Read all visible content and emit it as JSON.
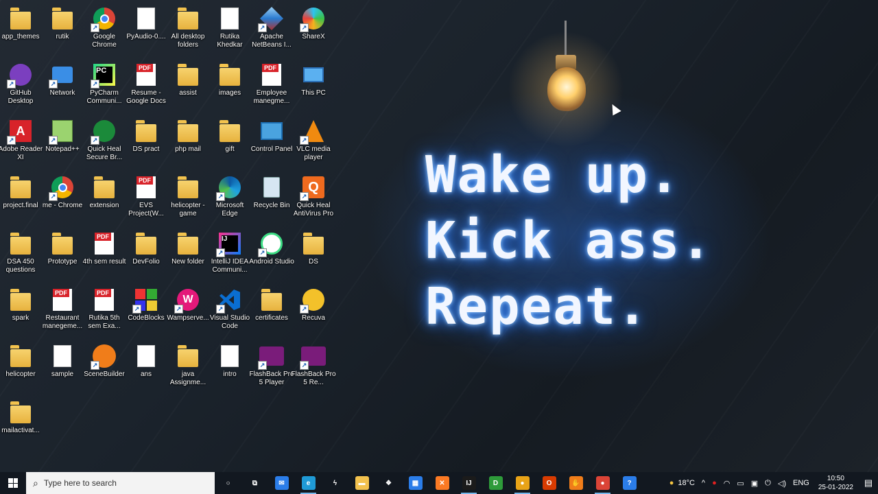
{
  "wallpaper": {
    "lines": [
      "Wake up.",
      "Kick ass.",
      "Repeat."
    ]
  },
  "desktop": {
    "icons": [
      {
        "label": "app_themes",
        "type": "folder"
      },
      {
        "label": "rutik",
        "type": "folder"
      },
      {
        "label": "Google Chrome",
        "type": "chrome"
      },
      {
        "label": "PyAudio-0....",
        "type": "doc"
      },
      {
        "label": "All desktop folders",
        "type": "folder"
      },
      {
        "label": "Rutika Khedkar",
        "type": "doc"
      },
      {
        "label": "Apache NetBeans I...",
        "type": "netbeans"
      },
      {
        "label": "ShareX",
        "type": "sharex"
      },
      {
        "label": "GitHub Desktop",
        "type": "github"
      },
      {
        "label": "Network",
        "type": "network"
      },
      {
        "label": "PyCharm Communi...",
        "type": "pycharm"
      },
      {
        "label": "Resume - Google Docs",
        "type": "pdf"
      },
      {
        "label": "assist",
        "type": "folder"
      },
      {
        "label": "images",
        "type": "folder"
      },
      {
        "label": "Employee manegme...",
        "type": "pdf"
      },
      {
        "label": "This PC",
        "type": "pc"
      },
      {
        "label": "Adobe Reader XI",
        "type": "adobe"
      },
      {
        "label": "Notepad++",
        "type": "notepad"
      },
      {
        "label": "Quick Heal Secure Br...",
        "type": "quickheal-browser"
      },
      {
        "label": "DS pract",
        "type": "folder"
      },
      {
        "label": "php mail",
        "type": "folder"
      },
      {
        "label": "gift",
        "type": "folder"
      },
      {
        "label": "Control Panel",
        "type": "control"
      },
      {
        "label": "VLC media player",
        "type": "vlc"
      },
      {
        "label": "project.final",
        "type": "folder"
      },
      {
        "label": "me - Chrome",
        "type": "chrome"
      },
      {
        "label": "extension",
        "type": "folder"
      },
      {
        "label": "EVS Project(W...",
        "type": "pdf"
      },
      {
        "label": "helicopter -game",
        "type": "folder"
      },
      {
        "label": "Microsoft Edge",
        "type": "edge"
      },
      {
        "label": "Recycle Bin",
        "type": "recycle"
      },
      {
        "label": "Quick Heal AntiVirus Pro",
        "type": "quickheal"
      },
      {
        "label": "DSA 450 questions",
        "type": "folder"
      },
      {
        "label": "Prototype",
        "type": "folder"
      },
      {
        "label": "4th sem result",
        "type": "pdf"
      },
      {
        "label": "DevFolio",
        "type": "folder"
      },
      {
        "label": "New folder",
        "type": "folder"
      },
      {
        "label": "IntelliJ IDEA Communi...",
        "type": "intellij"
      },
      {
        "label": "Android Studio",
        "type": "android"
      },
      {
        "label": "DS",
        "type": "folder"
      },
      {
        "label": "spark",
        "type": "folder"
      },
      {
        "label": "Restaurant manegeme...",
        "type": "pdf"
      },
      {
        "label": "Rutika 5th sem Exa...",
        "type": "pdf"
      },
      {
        "label": "CodeBlocks",
        "type": "codeblocks"
      },
      {
        "label": "Wampserve...",
        "type": "wamp"
      },
      {
        "label": "Visual Studio Code",
        "type": "vscode"
      },
      {
        "label": "certificates",
        "type": "folder"
      },
      {
        "label": "Recuva",
        "type": "recuva"
      },
      {
        "label": "helicopter",
        "type": "folder"
      },
      {
        "label": "sample",
        "type": "doc"
      },
      {
        "label": "SceneBuilder",
        "type": "scenebuilder"
      },
      {
        "label": "ans",
        "type": "doc"
      },
      {
        "label": "java Assignme...",
        "type": "folder"
      },
      {
        "label": "intro",
        "type": "doc"
      },
      {
        "label": "FlashBack Pro 5 Player",
        "type": "flashback"
      },
      {
        "label": "FlashBack Pro 5 Re...",
        "type": "flashback"
      },
      {
        "label": "mailactivat...",
        "type": "folder"
      }
    ]
  },
  "taskbar": {
    "search_placeholder": "Type here to search",
    "apps": [
      {
        "name": "cortana-icon",
        "glyph": "○",
        "color": "transparent"
      },
      {
        "name": "task-view-icon",
        "glyph": "⧉",
        "color": "transparent"
      },
      {
        "name": "mail-icon",
        "glyph": "✉",
        "color": "#2b7de9"
      },
      {
        "name": "edge-icon",
        "glyph": "e",
        "color": "#1f9ad6"
      },
      {
        "name": "power-automate-icon",
        "glyph": "ϟ",
        "color": "transparent"
      },
      {
        "name": "file-explorer-icon",
        "glyph": "▬",
        "color": "#f2c14e"
      },
      {
        "name": "dropbox-icon",
        "glyph": "❖",
        "color": "transparent"
      },
      {
        "name": "store-icon",
        "glyph": "▦",
        "color": "#2b7de9"
      },
      {
        "name": "xampp-icon",
        "glyph": "✕",
        "color": "#fb7a24"
      },
      {
        "name": "intellij-icon",
        "glyph": "IJ",
        "color": "#1b1b1b"
      },
      {
        "name": "camtasia-icon",
        "glyph": "D",
        "color": "#2e9b3a"
      },
      {
        "name": "chrome-icon",
        "glyph": "●",
        "color": "#e8a317"
      },
      {
        "name": "office-icon",
        "glyph": "O",
        "color": "#d83b01"
      },
      {
        "name": "scenebuilder-icon",
        "glyph": "✋",
        "color": "#f07d1a"
      },
      {
        "name": "chrome-alt-icon",
        "glyph": "●",
        "color": "#db4437"
      },
      {
        "name": "help-icon",
        "glyph": "?",
        "color": "#2b7de9"
      }
    ],
    "weather": "18°C",
    "language": "ENG",
    "time": "10:50",
    "date": "25-01-2022"
  }
}
